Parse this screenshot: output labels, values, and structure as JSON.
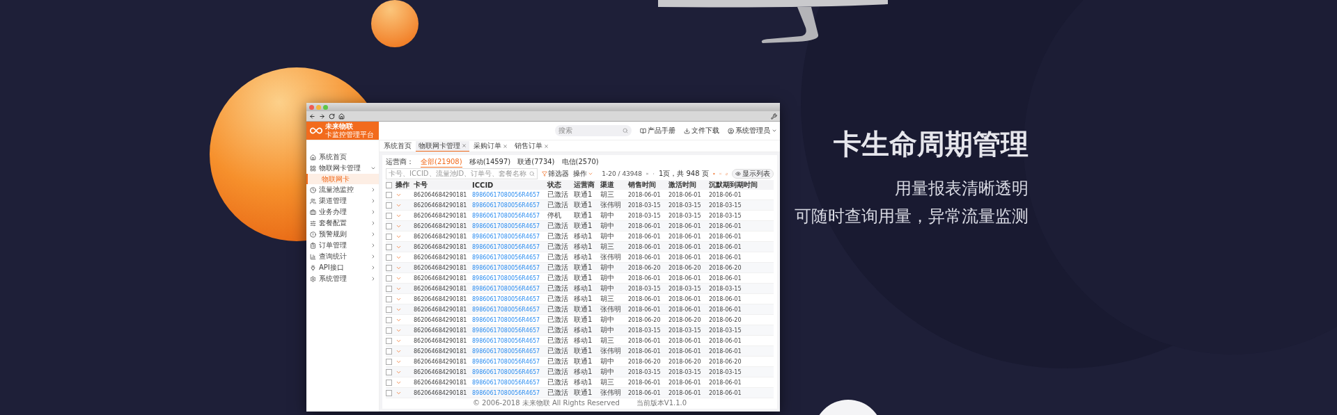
{
  "banner": {
    "title": "卡生命周期管理",
    "subtitles": [
      "用量报表清晰透明",
      "可随时查询用量，异常流量监测"
    ]
  },
  "app": {
    "logo": {
      "name": "未来物联",
      "tagline": "卡监控管理平台"
    },
    "search": {
      "placeholder": "搜索"
    },
    "header_links": [
      "产品手册",
      "文件下载"
    ],
    "user": "系统管理员",
    "tabs": [
      {
        "label": "系统首页",
        "selected": false,
        "closable": false
      },
      {
        "label": "物联网卡管理",
        "selected": true,
        "closable": true
      },
      {
        "label": "采购订单",
        "selected": false,
        "closable": true
      },
      {
        "label": "销售订单",
        "selected": false,
        "closable": true
      }
    ],
    "sidebar": {
      "items": [
        {
          "label": "系统首页",
          "kind": "link"
        },
        {
          "label": "物联网卡管理",
          "kind": "group",
          "expanded": true,
          "children": [
            {
              "label": "物联网卡",
              "selected": true
            }
          ]
        },
        {
          "label": "流量池监控",
          "kind": "group",
          "expanded": false
        },
        {
          "label": "渠道管理",
          "kind": "group",
          "expanded": false
        },
        {
          "label": "业务办理",
          "kind": "group",
          "expanded": false
        },
        {
          "label": "套餐配置",
          "kind": "group",
          "expanded": false
        },
        {
          "label": "预警规则",
          "kind": "group",
          "expanded": false
        },
        {
          "label": "订单管理",
          "kind": "group",
          "expanded": false
        },
        {
          "label": "查询统计",
          "kind": "group",
          "expanded": false
        },
        {
          "label": "API接口",
          "kind": "group",
          "expanded": false
        },
        {
          "label": "系统管理",
          "kind": "group",
          "expanded": false
        }
      ]
    },
    "filter": {
      "label": "运营商：",
      "options": [
        {
          "label": "全部(21908)",
          "selected": true
        },
        {
          "label": "移动(14597)",
          "selected": false
        },
        {
          "label": "联通(7734)",
          "selected": false
        },
        {
          "label": "电信(2570)",
          "selected": false
        }
      ]
    },
    "toolbar": {
      "search_placeholder": "卡号、ICCID、流量池ID、订单号、套餐名称",
      "filter_button": "筛选器",
      "actions": "操作",
      "range": "1-20 / 43948",
      "pager": "1页，共 948 页",
      "list_button": "显示列表"
    },
    "table": {
      "all_checked": false,
      "action_header": "操作",
      "columns": [
        "卡号",
        "ICCID",
        "状态",
        "运营商",
        "渠道",
        "销售时间",
        "激活时间",
        "沉默期到期时间"
      ],
      "rows": [
        {
          "checked": false,
          "cells": [
            "862064684290181",
            "89860617080056R4657",
            "已激活",
            "联通1",
            "胡三",
            "2018-06-01",
            "2018-06-01",
            "2018-06-01"
          ]
        },
        {
          "checked": false,
          "cells": [
            "862064684290181",
            "89860617080056R4657",
            "已激活",
            "联通1",
            "张伟明",
            "2018-03-15",
            "2018-03-15",
            "2018-03-15"
          ]
        },
        {
          "checked": false,
          "cells": [
            "862064684290181",
            "89860617080056R4657",
            "停机",
            "联通1",
            "胡中",
            "2018-03-15",
            "2018-03-15",
            "2018-03-15"
          ]
        },
        {
          "checked": false,
          "cells": [
            "862064684290181",
            "89860617080056R4657",
            "已激活",
            "联通1",
            "胡中",
            "2018-06-01",
            "2018-06-01",
            "2018-06-01"
          ]
        },
        {
          "checked": false,
          "cells": [
            "862064684290181",
            "89860617080056R4657",
            "已激活",
            "移动1",
            "胡中",
            "2018-06-01",
            "2018-06-01",
            "2018-06-01"
          ]
        },
        {
          "checked": false,
          "cells": [
            "862064684290181",
            "89860617080056R4657",
            "已激活",
            "移动1",
            "胡三",
            "2018-06-01",
            "2018-06-01",
            "2018-06-01"
          ]
        },
        {
          "checked": false,
          "cells": [
            "862064684290181",
            "89860617080056R4657",
            "已激活",
            "移动1",
            "张伟明",
            "2018-06-01",
            "2018-06-01",
            "2018-06-01"
          ]
        },
        {
          "checked": false,
          "cells": [
            "862064684290181",
            "89860617080056R4657",
            "已激活",
            "联通1",
            "胡中",
            "2018-06-20",
            "2018-06-20",
            "2018-06-20"
          ]
        },
        {
          "checked": false,
          "cells": [
            "862064684290181",
            "89860617080056R4657",
            "已激活",
            "联通1",
            "胡中",
            "2018-06-01",
            "2018-06-01",
            "2018-06-01"
          ]
        },
        {
          "checked": false,
          "cells": [
            "862064684290181",
            "89860617080056R4657",
            "已激活",
            "移动1",
            "胡中",
            "2018-03-15",
            "2018-03-15",
            "2018-03-15"
          ]
        },
        {
          "checked": false,
          "cells": [
            "862064684290181",
            "89860617080056R4657",
            "已激活",
            "移动1",
            "胡三",
            "2018-06-01",
            "2018-06-01",
            "2018-06-01"
          ]
        },
        {
          "checked": false,
          "cells": [
            "862064684290181",
            "89860617080056R4657",
            "已激活",
            "联通1",
            "张伟明",
            "2018-06-01",
            "2018-06-01",
            "2018-06-01"
          ]
        },
        {
          "checked": false,
          "cells": [
            "862064684290181",
            "89860617080056R4657",
            "已激活",
            "联通1",
            "胡中",
            "2018-06-20",
            "2018-06-20",
            "2018-06-20"
          ]
        },
        {
          "checked": false,
          "cells": [
            "862064684290181",
            "89860617080056R4657",
            "已激活",
            "移动1",
            "胡中",
            "2018-03-15",
            "2018-03-15",
            "2018-03-15"
          ]
        },
        {
          "checked": false,
          "cells": [
            "862064684290181",
            "89860617080056R4657",
            "已激活",
            "移动1",
            "胡三",
            "2018-06-01",
            "2018-06-01",
            "2018-06-01"
          ]
        },
        {
          "checked": false,
          "cells": [
            "862064684290181",
            "89860617080056R4657",
            "已激活",
            "联通1",
            "张伟明",
            "2018-06-01",
            "2018-06-01",
            "2018-06-01"
          ]
        },
        {
          "checked": false,
          "cells": [
            "862064684290181",
            "89860617080056R4657",
            "已激活",
            "联通1",
            "胡中",
            "2018-06-20",
            "2018-06-20",
            "2018-06-20"
          ]
        },
        {
          "checked": false,
          "cells": [
            "862064684290181",
            "89860617080056R4657",
            "已激活",
            "移动1",
            "胡中",
            "2018-03-15",
            "2018-03-15",
            "2018-03-15"
          ]
        },
        {
          "checked": false,
          "cells": [
            "862064684290181",
            "89860617080056R4657",
            "已激活",
            "移动1",
            "胡三",
            "2018-06-01",
            "2018-06-01",
            "2018-06-01"
          ]
        },
        {
          "checked": false,
          "cells": [
            "862064684290181",
            "89860617080056R4657",
            "已激活",
            "联通1",
            "张伟明",
            "2018-06-01",
            "2018-06-01",
            "2018-06-01"
          ]
        }
      ]
    },
    "footer": {
      "copyright": "© 2006-2018 未来物联 All Rights Reserved",
      "version": "当前版本V1.1.0"
    }
  }
}
